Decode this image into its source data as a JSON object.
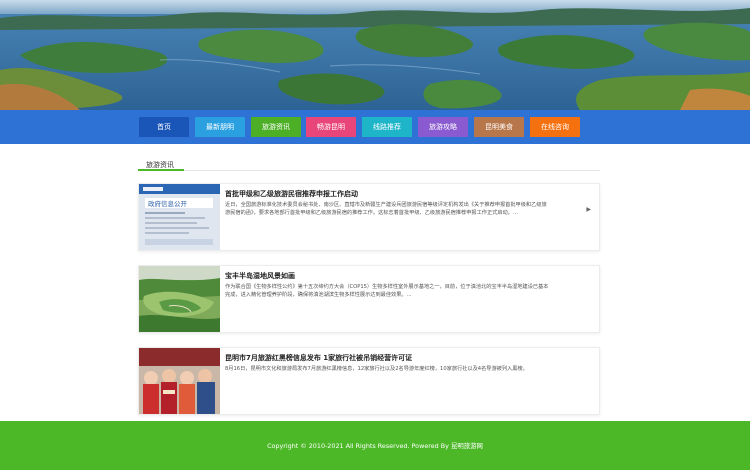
{
  "banner": {
    "alt": "lake-islands-landscape"
  },
  "nav": {
    "items": [
      {
        "label": "首页",
        "color": "#1a55b8"
      },
      {
        "label": "最新朋明",
        "color": "#2aa0e0"
      },
      {
        "label": "旅游资讯",
        "color": "#4caf26"
      },
      {
        "label": "畅游昆明",
        "color": "#e8457a"
      },
      {
        "label": "线路推荐",
        "color": "#1fb5c9"
      },
      {
        "label": "旅游攻略",
        "color": "#8a5ad0"
      },
      {
        "label": "昆明美食",
        "color": "#b8774a"
      },
      {
        "label": "在线咨询",
        "color": "#f5700f"
      }
    ]
  },
  "section": {
    "title": "旅游资讯"
  },
  "articles": [
    {
      "title": "首批甲级和乙级旅游民宿推荐申报工作启动",
      "desc": "近日，全国旅游标准化技术委员会秘书处、南沙区、直辖市及新疆生产建设兵团旅游民宿等级评定机构发出《关于推荐申报首批甲级和乙级旅游民宿的函》，要求各地部行首批甲级和乙级旅游民宿的推荐工作。这标志着首批甲级、乙级旅游民宿推荐申报工作正式启动。...",
      "arrow": "▶"
    },
    {
      "title": "宝丰半岛湿地风景如画",
      "desc": "作为联合国《生物多样性公约》第十五次缔约方大会（COP15）生物多样性室外展示基地之一，目前，位于滇池北的宝丰半岛湿地建设已基本完成，进入精化管理养护阶段，确保将滇池湖滨生物多样性展示达到最佳效果。...",
      "arrow": ""
    },
    {
      "title": "昆明市7月旅游红黑榜信息发布 1家旅行社被吊销经营许可证",
      "desc": "8月16日，昆明市文化和旅游局发布7月旅游红黑榜信息，12家旅行社以及2名导游年度红榜，10家旅行社以及4名导游被列入黑榜。",
      "arrow": ""
    }
  ],
  "footer": {
    "copyright": "Copyright © 2010-2021 All Rights Reserved. Powered By 昆明旅游网"
  }
}
